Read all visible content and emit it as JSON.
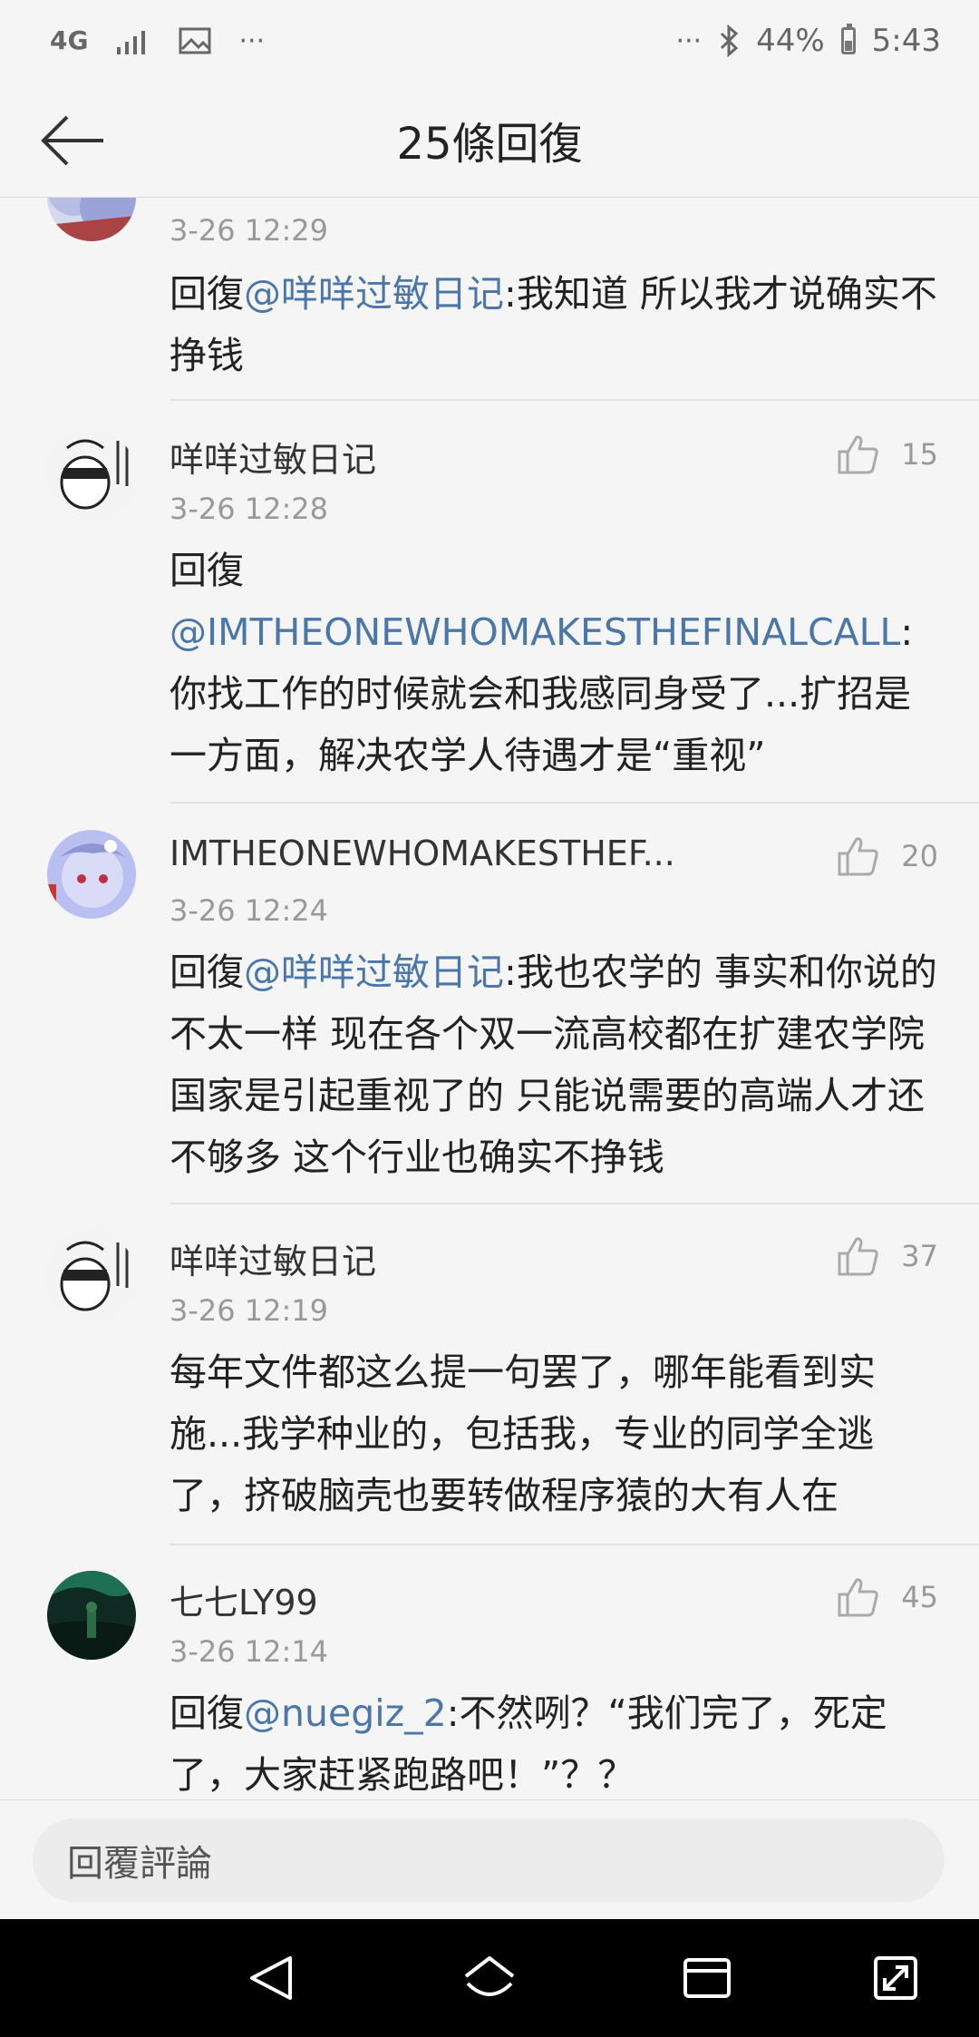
{
  "status_bar": {
    "network": "4G",
    "right_text": "···",
    "battery": "44%",
    "time": "5:43"
  },
  "header": {
    "title": "25條回復"
  },
  "comments": [
    {
      "time": "3-26 12:29",
      "prefix": "回復",
      "mention": "@咩咩过敏日记",
      "text": ":我知道 所以我才说确实不挣钱"
    },
    {
      "name": "咩咩过敏日记",
      "time": "3-26 12:28",
      "likes": "15",
      "prefix": "回復",
      "mention": "@IMTHEONEWHOMAKESTHEFINALCALL",
      "text": ":你找工作的时候就会和我感同身受了...扩招是一方面，解决农学人待遇才是“重视”"
    },
    {
      "name": "IMTHEONEWHOMAKESTHEF...",
      "time": "3-26 12:24",
      "likes": "20",
      "prefix": "回復",
      "mention": "@咩咩过敏日记",
      "text": ":我也农学的 事实和你说的不太一样 现在各个双一流高校都在扩建农学院 国家是引起重视了的 只能说需要的高端人才还不够多 这个行业也确实不挣钱"
    },
    {
      "name": "咩咩过敏日记",
      "time": "3-26 12:19",
      "likes": "37",
      "text": "每年文件都这么提一句罢了，哪年能看到实施...我学种业的，包括我，专业的同学全逃了，挤破脑壳也要转做程序猿的大有人在"
    },
    {
      "name": "七七LY99",
      "time": "3-26 12:14",
      "likes": "45",
      "prefix": "回復",
      "mention": "@nuegiz_2",
      "text": ":不然咧？“我们完了，死定了，大家赶紧跑路吧！”？？"
    }
  ],
  "reply_bar": {
    "placeholder": "回覆評論"
  },
  "colors": {
    "mention": "#4a77a8",
    "background": "#f5f5f5"
  }
}
